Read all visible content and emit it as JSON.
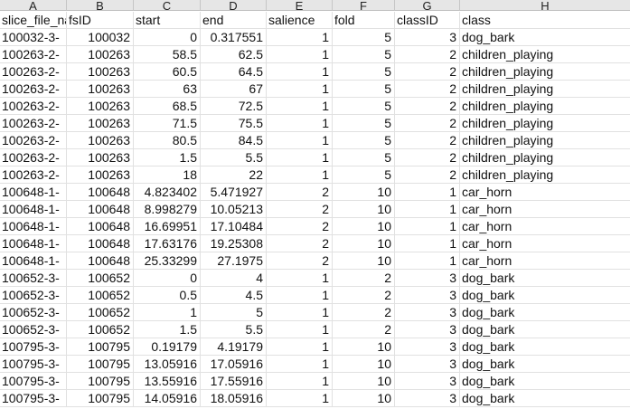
{
  "column_letters": [
    "A",
    "B",
    "C",
    "D",
    "E",
    "F",
    "G",
    "H"
  ],
  "header": [
    "slice_file_na",
    "fsID",
    "start",
    "end",
    "salience",
    "fold",
    "classID",
    "class"
  ],
  "rows": [
    [
      "100032-3-",
      "100032",
      "0",
      "0.317551",
      "1",
      "5",
      "3",
      "dog_bark"
    ],
    [
      "100263-2-",
      "100263",
      "58.5",
      "62.5",
      "1",
      "5",
      "2",
      "children_playing"
    ],
    [
      "100263-2-",
      "100263",
      "60.5",
      "64.5",
      "1",
      "5",
      "2",
      "children_playing"
    ],
    [
      "100263-2-",
      "100263",
      "63",
      "67",
      "1",
      "5",
      "2",
      "children_playing"
    ],
    [
      "100263-2-",
      "100263",
      "68.5",
      "72.5",
      "1",
      "5",
      "2",
      "children_playing"
    ],
    [
      "100263-2-",
      "100263",
      "71.5",
      "75.5",
      "1",
      "5",
      "2",
      "children_playing"
    ],
    [
      "100263-2-",
      "100263",
      "80.5",
      "84.5",
      "1",
      "5",
      "2",
      "children_playing"
    ],
    [
      "100263-2-",
      "100263",
      "1.5",
      "5.5",
      "1",
      "5",
      "2",
      "children_playing"
    ],
    [
      "100263-2-",
      "100263",
      "18",
      "22",
      "1",
      "5",
      "2",
      "children_playing"
    ],
    [
      "100648-1-",
      "100648",
      "4.823402",
      "5.471927",
      "2",
      "10",
      "1",
      "car_horn"
    ],
    [
      "100648-1-",
      "100648",
      "8.998279",
      "10.05213",
      "2",
      "10",
      "1",
      "car_horn"
    ],
    [
      "100648-1-",
      "100648",
      "16.69951",
      "17.10484",
      "2",
      "10",
      "1",
      "car_horn"
    ],
    [
      "100648-1-",
      "100648",
      "17.63176",
      "19.25308",
      "2",
      "10",
      "1",
      "car_horn"
    ],
    [
      "100648-1-",
      "100648",
      "25.33299",
      "27.1975",
      "2",
      "10",
      "1",
      "car_horn"
    ],
    [
      "100652-3-",
      "100652",
      "0",
      "4",
      "1",
      "2",
      "3",
      "dog_bark"
    ],
    [
      "100652-3-",
      "100652",
      "0.5",
      "4.5",
      "1",
      "2",
      "3",
      "dog_bark"
    ],
    [
      "100652-3-",
      "100652",
      "1",
      "5",
      "1",
      "2",
      "3",
      "dog_bark"
    ],
    [
      "100652-3-",
      "100652",
      "1.5",
      "5.5",
      "1",
      "2",
      "3",
      "dog_bark"
    ],
    [
      "100795-3-",
      "100795",
      "0.19179",
      "4.19179",
      "1",
      "10",
      "3",
      "dog_bark"
    ],
    [
      "100795-3-",
      "100795",
      "13.05916",
      "17.05916",
      "1",
      "10",
      "3",
      "dog_bark"
    ],
    [
      "100795-3-",
      "100795",
      "13.55916",
      "17.55916",
      "1",
      "10",
      "3",
      "dog_bark"
    ],
    [
      "100795-3-",
      "100795",
      "14.05916",
      "18.05916",
      "1",
      "10",
      "3",
      "dog_bark"
    ]
  ]
}
